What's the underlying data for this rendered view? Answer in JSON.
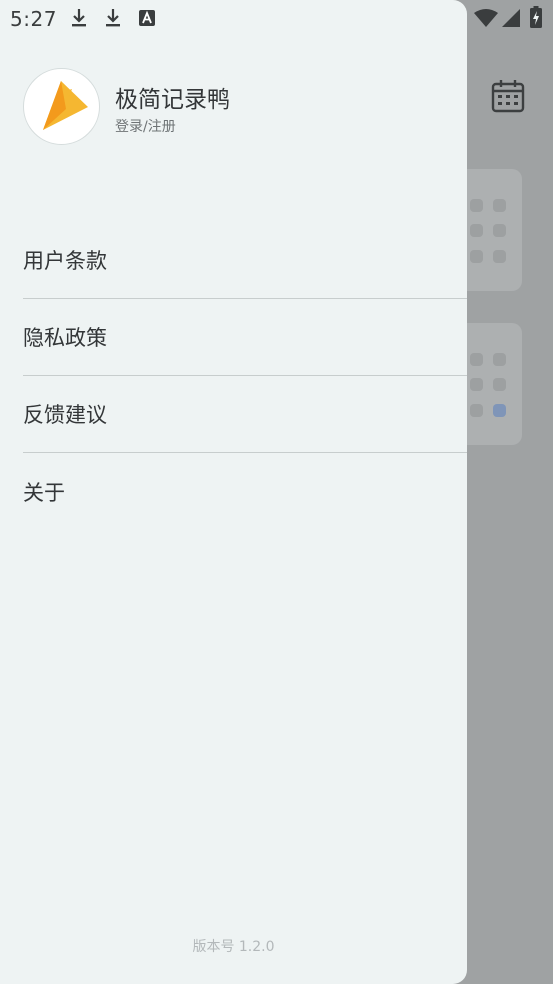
{
  "status_bar": {
    "time": "5:27",
    "left_icons": [
      "download-icon",
      "download-icon",
      "font-app-icon"
    ],
    "right_icons": [
      "wifi-icon",
      "signal-icon",
      "battery-charging-icon"
    ]
  },
  "drawer": {
    "app_name": "极简记录鸭",
    "login_label": "登录/注册",
    "menu_items": [
      {
        "label": "用户条款"
      },
      {
        "label": "隐私政策"
      },
      {
        "label": "反馈建议"
      },
      {
        "label": "关于"
      }
    ],
    "version": "版本号 1.2.0"
  },
  "colors": {
    "drawer_bg": "#eef3f3",
    "scrim": "#9fa2a3",
    "logo_yellow": "#f5b731",
    "logo_orange": "#f39a1c"
  }
}
